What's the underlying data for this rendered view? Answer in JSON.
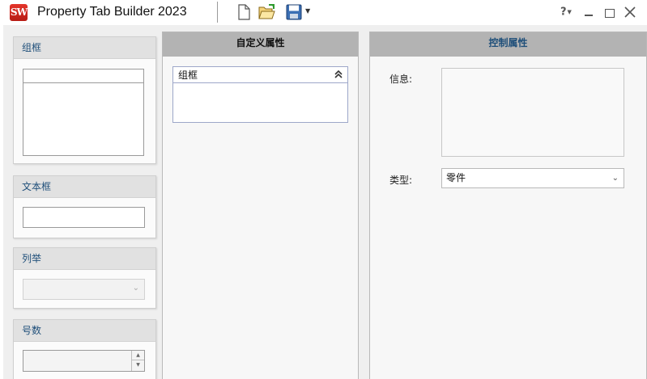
{
  "titlebar": {
    "logo_text": "SW",
    "app_name": "Property Tab Builder",
    "app_year": "2023",
    "help_label": "?"
  },
  "palette": {
    "group_box": {
      "label": "组框"
    },
    "text_box": {
      "label": "文本框"
    },
    "list_enum": {
      "label": "列举"
    },
    "number": {
      "label": "号数"
    }
  },
  "custom_properties": {
    "header": "自定义属性",
    "group": {
      "label": "组框"
    }
  },
  "control_properties": {
    "header": "控制属性",
    "info_label": "信息:",
    "type_label": "类型:",
    "type_value": "零件"
  },
  "colors": {
    "accent_text": "#1f4f7a",
    "column_header": "#b3b3b3",
    "workspace": "#efefef",
    "logo_red": "#d32a20"
  }
}
